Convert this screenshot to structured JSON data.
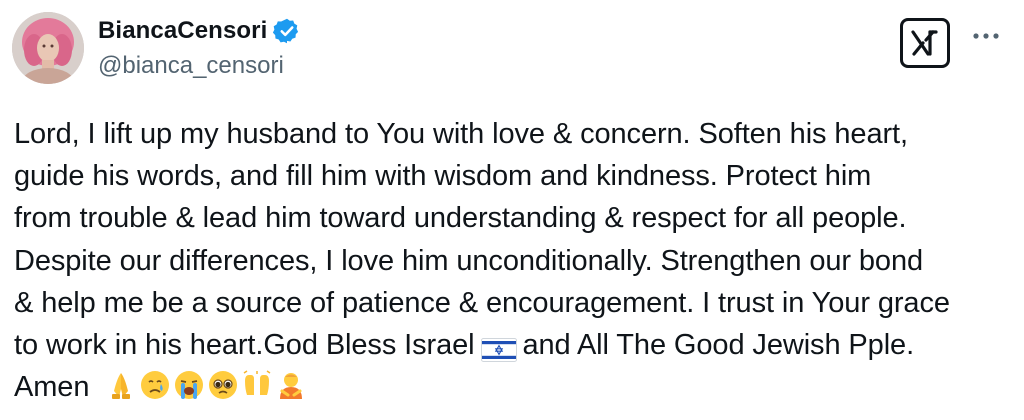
{
  "author": {
    "display_name": "BiancaCensori",
    "handle": "@bianca_censori",
    "verified": true
  },
  "post": {
    "lines": [
      "Lord, I lift up my husband to You with love & concern. Soften his heart,",
      "guide his words, and fill him with wisdom and kindness. Protect him",
      "from trouble & lead him toward understanding & respect for all people.",
      "Despite our differences, I love him unconditionally. Strengthen our bond",
      "& help me be a source of patience & encouragement. I trust in Your grace"
    ],
    "line6_before_flag": "to work in his heart.God Bless Israel",
    "line6_after_flag": "and All The Good Jewish Pple.",
    "last_line": "Amen",
    "emojis": [
      "folded-hands",
      "crying-face",
      "loudly-crying-face",
      "pleading-face",
      "raising-hands",
      "person-bowing"
    ]
  },
  "icons": {
    "platform_logo": "x-logo-icon",
    "more": "more-options-icon",
    "flag": "israel-flag-icon"
  },
  "colors": {
    "text": "#0f1419",
    "secondary": "#536471",
    "verified_blue": "#1d9bf0",
    "flag_blue": "#1f4fb5"
  }
}
